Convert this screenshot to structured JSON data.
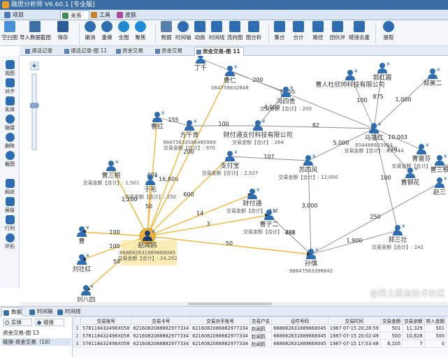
{
  "app": {
    "title": "融思分析师 V6.60.1 [专业版]"
  },
  "main_tabs": [
    {
      "label": "项目",
      "active": false
    },
    {
      "label": "关系",
      "active": true
    },
    {
      "label": "工具",
      "active": false
    },
    {
      "label": "皮肤",
      "active": false
    }
  ],
  "toolbar": {
    "buttons": [
      {
        "label": "空白图",
        "icon": "blank-graph-icon"
      },
      {
        "label": "导入数据截图",
        "icon": "import-data-icon"
      },
      {
        "label": "保存",
        "icon": "save-icon"
      },
      {
        "label": "撤消",
        "icon": "undo-icon"
      },
      {
        "label": "重做",
        "icon": "redo-icon"
      },
      {
        "label": "全图",
        "icon": "fit-all-icon"
      },
      {
        "label": "聚焦",
        "icon": "focus-icon"
      },
      {
        "label": "数据",
        "icon": "data-table-icon"
      },
      {
        "label": "时间轴",
        "icon": "clock-icon"
      },
      {
        "label": "动画",
        "icon": "animation-icon"
      },
      {
        "label": "时间线",
        "icon": "timeline-icon"
      },
      {
        "label": "流向图",
        "icon": "flow-chart-icon"
      },
      {
        "label": "图分析",
        "icon": "graph-analysis-icon"
      },
      {
        "label": "集合",
        "icon": "collection-icon"
      },
      {
        "label": "合计",
        "icon": "sum-icon"
      },
      {
        "label": "路径",
        "icon": "path-icon"
      },
      {
        "label": "团伙并",
        "icon": "group-merge-icon"
      },
      {
        "label": "链接去重",
        "icon": "dedupe-link-icon"
      },
      {
        "label": "提取",
        "icon": "extract-icon"
      }
    ]
  },
  "doc_tabs": [
    {
      "label": "通话记录",
      "active": false
    },
    {
      "label": "通话记录-图 11",
      "active": false
    },
    {
      "label": "资金交易",
      "active": false
    },
    {
      "label": "资金交易",
      "active": false
    },
    {
      "label": "资金交易-图 11",
      "active": true
    }
  ],
  "left_tools": [
    {
      "label": "视图",
      "icon": "view-icon"
    },
    {
      "label": "对齐",
      "icon": "align-icon"
    },
    {
      "label": "实体",
      "icon": "entity-icon"
    },
    {
      "label": "链接",
      "icon": "link-icon"
    },
    {
      "label": "删除",
      "icon": "delete-icon"
    },
    {
      "label": "截图",
      "icon": "screenshot-icon"
    },
    {
      "label": "网状",
      "icon": "mesh-layout-icon"
    },
    {
      "label": "层级",
      "icon": "hierarchy-layout-icon"
    },
    {
      "label": "行列",
      "icon": "grid-layout-icon"
    },
    {
      "label": "环形",
      "icon": "circle-layout-icon"
    }
  ],
  "graph": {
    "nodes": [
      {
        "id": "zhao",
        "name": "赵闻鸥",
        "sub1": "668682631889668045",
        "sub2": "交易金额【合计】: 24,292",
        "highlight": true
      },
      {
        "id": "caohong",
        "name": "曹红",
        "sub1": "",
        "sub2": ""
      },
      {
        "id": "fangqing",
        "name": "方千青",
        "sub1": "98475633586485969",
        "sub2": "交易金额【合计】: 970"
      },
      {
        "id": "zhifu",
        "name": "支付宝",
        "sub1": "",
        "sub2": "交易金额【合计】: 2,527"
      },
      {
        "id": "caisan",
        "name": "曹三根",
        "sub1": "",
        "sub2": "交易金额【合计】: 1,501"
      },
      {
        "id": "yu",
        "name": "于毛",
        "sub1": "",
        "sub2": "交易金额【合计】: 250"
      },
      {
        "id": "cao",
        "name": "曹",
        "sub1": "",
        "sub2": ""
      },
      {
        "id": "liuzhuhong",
        "name": "刘壮红",
        "sub1": "",
        "sub2": ""
      },
      {
        "id": "liubasi",
        "name": "刘八四",
        "sub1": "",
        "sub2": ""
      },
      {
        "id": "caicaitong",
        "name": "财付通",
        "sub1": "",
        "sub2": "交易金额【合计】: 212"
      },
      {
        "id": "caozi",
        "name": "曹子二",
        "sub1": "",
        "sub2": "交易金额【合计】: 202"
      },
      {
        "id": "caicai2",
        "name": "财付通支付科技有限公司",
        "sub1": "",
        "sub2": "交易金额【合计】: 264"
      },
      {
        "id": "feng",
        "name": "冯四贵",
        "sub1": "",
        "sub2": "交易金额【合计】: 200"
      },
      {
        "id": "caoren",
        "name": "曹仁",
        "sub1": "064758632848",
        "sub2": ""
      },
      {
        "id": "sudi",
        "name": "苏四风",
        "sub1": "",
        "sub2": "交易金额【合计】: 12,000"
      },
      {
        "id": "mazhuhong",
        "name": "马藩红",
        "sub1": "654486633984",
        "sub2": "交易金额【合计】: 21,944"
      },
      {
        "id": "caofu",
        "name": "曹富芬",
        "sub1": "",
        "sub2": "交易金额【合计】: 10,003"
      },
      {
        "id": "caogang",
        "name": "曹钢花",
        "sub1": "",
        "sub2": ""
      },
      {
        "id": "zhaosan",
        "name": "赵三",
        "sub1": "",
        "sub2": ""
      },
      {
        "id": "zhengsan",
        "name": "郑三壮",
        "sub1": "",
        "sub2": "交易金额【合计】: 242"
      },
      {
        "id": "sunjin",
        "name": "孙慎",
        "sub1": "98847563396842",
        "sub2": ""
      },
      {
        "id": "caoren2",
        "name": "曹人杜欣帅科技有限公司",
        "sub1": "",
        "sub2": ""
      },
      {
        "id": "guohong",
        "name": "郭红霞",
        "sub1": "",
        "sub2": ""
      },
      {
        "id": "zhengmei",
        "name": "郑美二",
        "sub1": "",
        "sub2": ""
      },
      {
        "id": "ding",
        "name": "丁千",
        "sub1": "",
        "sub2": ""
      },
      {
        "id": "caocai",
        "name": "曹三根",
        "sub1": "",
        "sub2": ""
      }
    ],
    "edges": [
      {
        "from": "zhao",
        "to": "caohong",
        "label": "401"
      },
      {
        "from": "zhao",
        "to": "fangqing",
        "label": "16,806"
      },
      {
        "from": "zhao",
        "to": "zhifu",
        "label": "600"
      },
      {
        "from": "zhao",
        "to": "caicaitong",
        "label": "14"
      },
      {
        "from": "zhao",
        "to": "caozi",
        "label": "3"
      },
      {
        "from": "zhao",
        "to": "caisan",
        "label": "1,200"
      },
      {
        "from": "zhao",
        "to": "yu",
        "label": "50"
      },
      {
        "from": "zhao",
        "to": "cao",
        "label": "100"
      },
      {
        "from": "zhao",
        "to": "liuzhuhong",
        "label": "100"
      },
      {
        "from": "zhao",
        "to": "liubasi",
        "label": "50"
      },
      {
        "from": "zhao",
        "to": "sunjin",
        "label": "50"
      },
      {
        "from": "zhao",
        "to": "caoren",
        "label": "200"
      },
      {
        "from": "caohong",
        "to": "fangqing",
        "label": "155"
      },
      {
        "from": "fangqing",
        "to": "caicai2",
        "label": "100"
      },
      {
        "from": "caicai2",
        "to": "mazhuhong",
        "label": "82"
      },
      {
        "from": "caicai2",
        "to": "feng",
        "label": "4,000"
      },
      {
        "from": "caoren",
        "to": "feng",
        "label": "200"
      },
      {
        "from": "zhifu",
        "to": "sudi",
        "label": "107"
      },
      {
        "from": "sudi",
        "to": "mazhuhong",
        "label": "5,000"
      },
      {
        "from": "sudi",
        "to": "sunjin",
        "label": "3,000"
      },
      {
        "from": "mazhuhong",
        "to": "caofu",
        "label": "10,003"
      },
      {
        "from": "mazhuhong",
        "to": "zhengsan",
        "label": "100"
      },
      {
        "from": "mazhuhong",
        "to": "caogang",
        "label": "230"
      },
      {
        "from": "caozi",
        "to": "sunjin",
        "label": "488"
      },
      {
        "from": "sunjin",
        "to": "zhengsan",
        "label": "1,900"
      },
      {
        "from": "sunjin",
        "to": "zhaosan",
        "label": "250"
      },
      {
        "from": "caoren2",
        "to": "mazhuhong",
        "label": "100"
      },
      {
        "from": "guohong",
        "to": "mazhuhong",
        "label": "875"
      },
      {
        "from": "zhengmei",
        "to": "mazhuhong",
        "label": "1,000"
      },
      {
        "from": "ding",
        "to": "mazhuhong",
        "label": "7,805"
      }
    ]
  },
  "bottom": {
    "tabs": [
      {
        "label": "数据",
        "active": true
      },
      {
        "label": "时间轴",
        "active": false
      },
      {
        "label": "时间线",
        "active": false
      }
    ],
    "radio_entity": "实体",
    "radio_link": "链接",
    "list": [
      {
        "label": "资金交易-图 13",
        "selected": false
      },
      {
        "label": "链接-资金交易（10）",
        "selected": true
      }
    ],
    "columns": [
      "",
      "交易账号",
      "交易卡号",
      "交易对手账号",
      "交易户名",
      "证件号码",
      "交易时间",
      "交易金额",
      "交易余额",
      "转入金额"
    ],
    "rows": [
      [
        "1",
        "578118432498X058",
        "6216082088882977334",
        "6216082088882977334",
        "赵闻鸥",
        "66868263188966804​5",
        "1987-07-15 20:28:59",
        "501",
        "11,329",
        "501"
      ],
      [
        "2",
        "578118432498X058",
        "6216082088882977334",
        "6216082088882977334",
        "赵闻鸥",
        "668682631889668045",
        "1987-07-15 20:02:49",
        "500",
        "10,828",
        "500"
      ],
      [
        "3",
        "578118432498X058",
        "6216082088882977334",
        "6216082088882977334",
        "赵闻鸥",
        "668682631889668045",
        "1987-07-15 17:53:48",
        "6,105",
        "7",
        "0"
      ]
    ]
  },
  "watermark": "@稀土掘金技术社区"
}
